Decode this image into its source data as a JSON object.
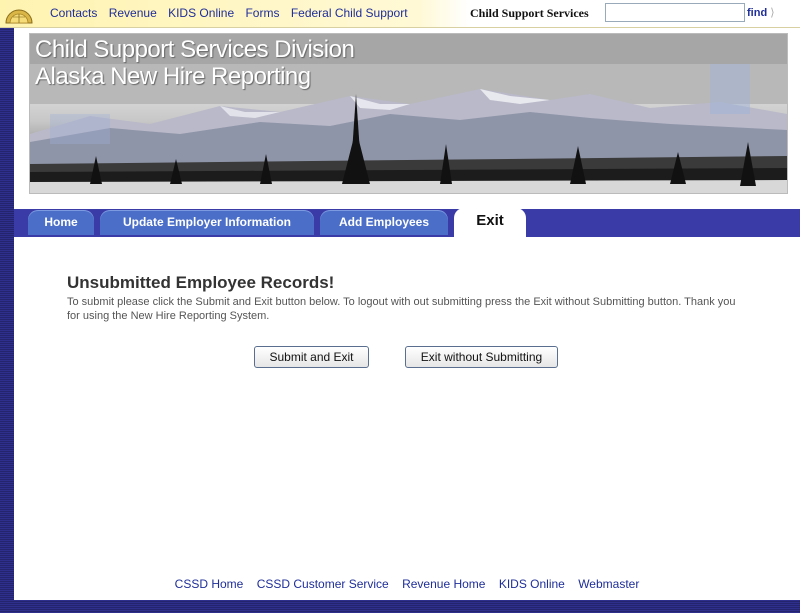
{
  "topnav": {
    "links": [
      "Contacts",
      "Revenue",
      "KIDS Online",
      "Forms",
      "Federal Child Support"
    ],
    "label": "Child Support Services",
    "search_value": "",
    "find_label": "find",
    "find_arrow": "⟩"
  },
  "banner": {
    "title": "Child Support Services Division",
    "subtitle": "Alaska New Hire Reporting"
  },
  "tabs": [
    {
      "label": "Home",
      "active": false
    },
    {
      "label": "Update Employer Information",
      "active": false
    },
    {
      "label": "Add Employees",
      "active": false
    },
    {
      "label": "Exit",
      "active": true
    }
  ],
  "main": {
    "heading": "Unsubmitted Employee Records!",
    "message": "To submit please click the Submit and Exit button below. To logout with out submitting press the Exit without Submitting button. Thank you for using the New Hire Reporting System.",
    "submit_label": "Submit and Exit",
    "exit_label": "Exit without Submitting"
  },
  "footer": {
    "links": [
      "CSSD Home",
      "CSSD Customer Service",
      "Revenue Home",
      "KIDS Online",
      "Webmaster"
    ]
  },
  "colors": {
    "link": "#1f2e99",
    "tab": "#4b6fc8",
    "tab_band": "#3b3ba8",
    "frame": "#2a2a80"
  }
}
